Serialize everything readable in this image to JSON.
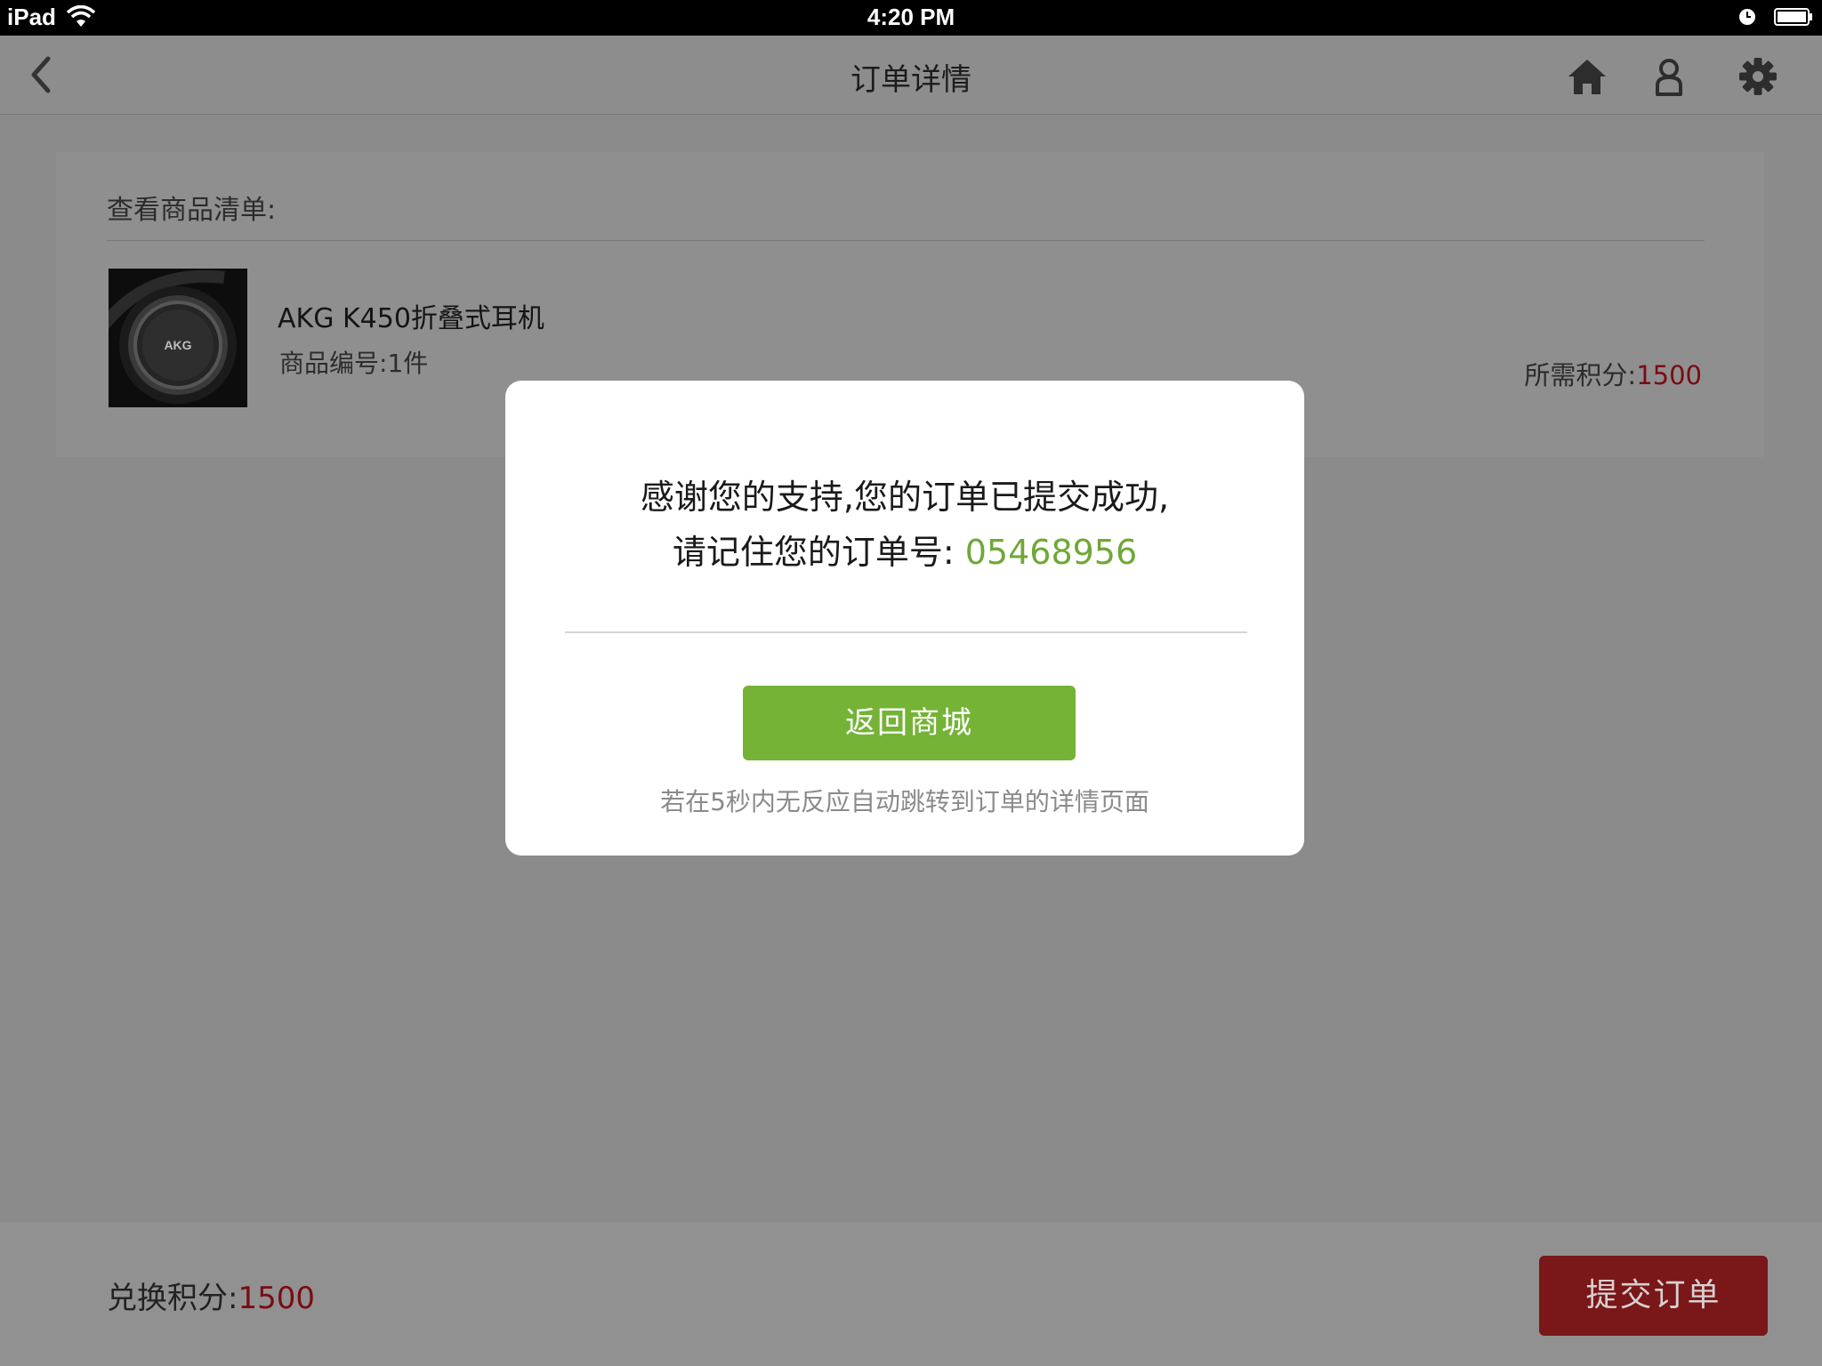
{
  "status_bar": {
    "device": "iPad",
    "time": "4:20 PM"
  },
  "nav": {
    "title": "订单详情"
  },
  "product_panel": {
    "heading": "查看商品清单:",
    "item": {
      "name": "AKG K450折叠式耳机",
      "brand_logo": "AKG",
      "qty_label": "商品编号:",
      "qty_value": "1件",
      "points_label": "所需积分:",
      "points_value": "1500"
    }
  },
  "bottom_bar": {
    "label": "兑换积分:",
    "value": "1500",
    "submit_label": "提交订单"
  },
  "modal": {
    "line1": "感谢您的支持,您的订单已提交成功,",
    "line2_prefix": "请记住您的订单号: ",
    "order_number": "05468956",
    "button_label": "返回商城",
    "hint": "若在5秒内无反应自动跳转到订单的详情页面"
  },
  "colors": {
    "accent_green": "#74b335",
    "order_number_green": "#6ea836",
    "points_red": "#7a0c12",
    "submit_red": "#7a1719",
    "overlay_gray": "#8b8b8b"
  },
  "icons": [
    "wifi-icon",
    "alarm-clock-icon",
    "battery-icon",
    "back-chevron-icon",
    "home-icon",
    "user-icon",
    "gear-icon"
  ]
}
